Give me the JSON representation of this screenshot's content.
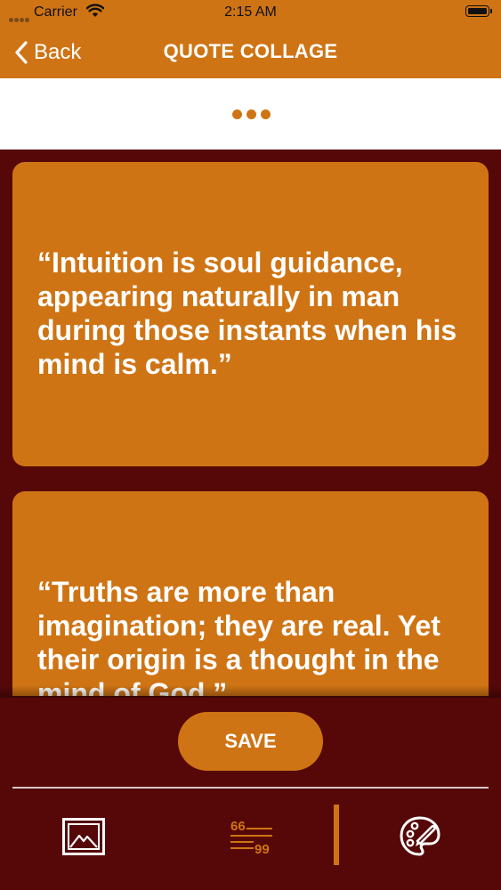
{
  "status_bar": {
    "carrier": "Carrier",
    "time": "2:15 AM"
  },
  "nav": {
    "back_label": "Back",
    "title": "QUOTE COLLAGE"
  },
  "quotes": [
    {
      "text": "“Intuition is soul guidance, appearing naturally in man during those instants when his mind is calm.”"
    },
    {
      "text": "“Truths are more than imagination; they are real. Yet their origin is a thought in the mind of God.”"
    }
  ],
  "actions": {
    "save_label": "SAVE"
  },
  "toolbar": {
    "items": [
      {
        "icon": "image-icon"
      },
      {
        "icon": "quote-text-icon"
      },
      {
        "icon": "palette-icon"
      }
    ]
  },
  "colors": {
    "accent": "#cf7414",
    "background": "#560808",
    "white": "#ffffff"
  }
}
